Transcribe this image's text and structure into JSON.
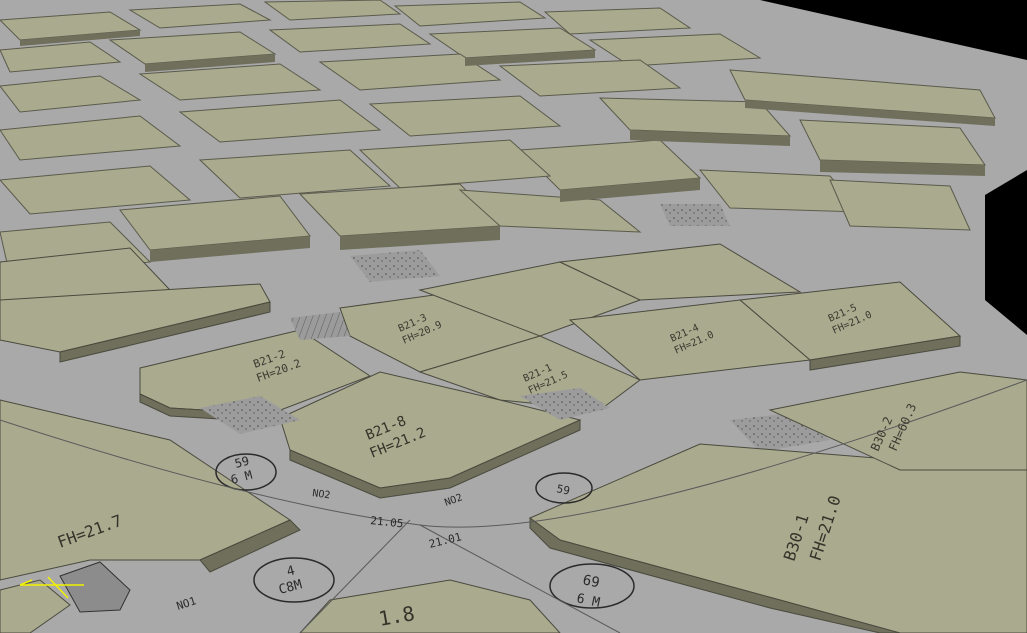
{
  "colors": {
    "background": "#000000",
    "road": "#a9a9a9",
    "plot_top": "#a9aa8e",
    "plot_side": "#6f6f5c",
    "roof_line": "#4a4a3e",
    "cursor_marker": "#f2f200"
  },
  "plots": {
    "b21_2": {
      "id": "B21-2",
      "fh": "FH=20.2"
    },
    "b21_8": {
      "id": "B21-8",
      "fh": "FH=21.2"
    },
    "b21_1": {
      "id": "B21-1",
      "fh": "FH=21.5"
    },
    "b21_3": {
      "id": "B21-3",
      "fh": "FH=20.9"
    },
    "b21_4": {
      "id": "B21-4",
      "fh": "FH=21.0"
    },
    "b21_5": {
      "id": "B21-5",
      "fh": "FH=21.0"
    },
    "b30_1": {
      "id": "B30-1",
      "fh": "FH=21.0"
    },
    "b30_2": {
      "id": "B30-2",
      "fh": "FH=60.3"
    },
    "left": {
      "fh": "FH=21.7"
    },
    "bottom": {
      "value": "1.8"
    }
  },
  "roads": {
    "circle_1": {
      "top": "59",
      "bottom": "6 M"
    },
    "circle_2": {
      "top": "4",
      "bottom": "C8M"
    },
    "circle_3": {
      "top": "69",
      "bottom": "6 M"
    },
    "circle_4": {
      "top": "59"
    },
    "road_no_1": "NO2",
    "road_no_2": "NO2",
    "road_no_3": "NO1",
    "elev_1": "21.05",
    "elev_2": "21.01"
  }
}
